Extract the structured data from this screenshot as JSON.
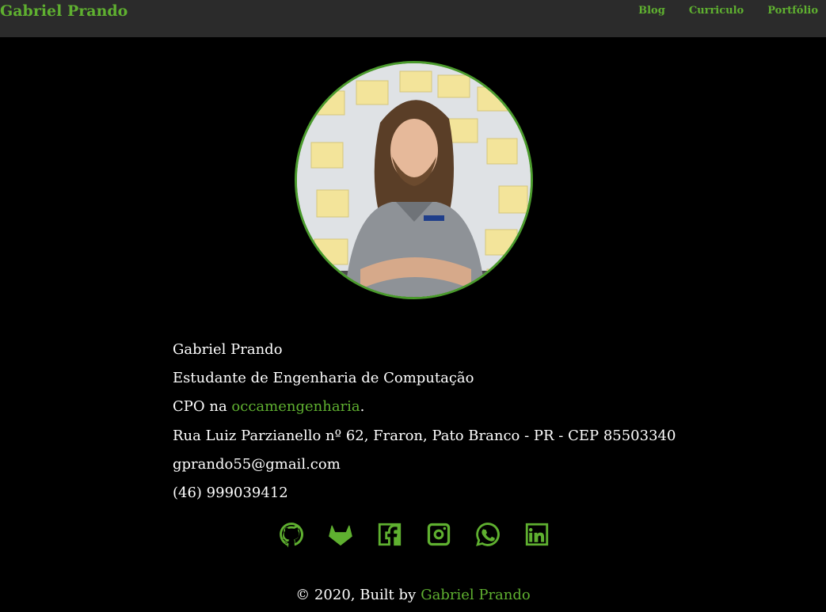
{
  "navbar": {
    "brand": "Gabriel Prando",
    "links": [
      {
        "label": "Blog"
      },
      {
        "label": "Curriculo"
      },
      {
        "label": "Portfólio"
      }
    ]
  },
  "profile": {
    "name": "Gabriel Prando",
    "role": "Estudante de Engenharia de Computação",
    "cpo_prefix": "CPO na ",
    "company": "occamengenharia",
    "cpo_suffix": ".",
    "address": "Rua Luiz Parzianello nº 62, Fraron, Pato Branco - PR - CEP 85503340",
    "email": "gprando55@gmail.com",
    "phone": "(46) 999039412"
  },
  "socials": [
    {
      "icon": "github-icon"
    },
    {
      "icon": "gitlab-icon"
    },
    {
      "icon": "facebook-icon"
    },
    {
      "icon": "instagram-icon"
    },
    {
      "icon": "whatsapp-icon"
    },
    {
      "icon": "linkedin-icon"
    }
  ],
  "footer": {
    "copyright": "© 2020, Built by",
    "author": "Gabriel Prando"
  },
  "colors": {
    "accent": "#5fb030",
    "navbar_bg": "#2b2b2b",
    "page_bg": "#000000"
  }
}
